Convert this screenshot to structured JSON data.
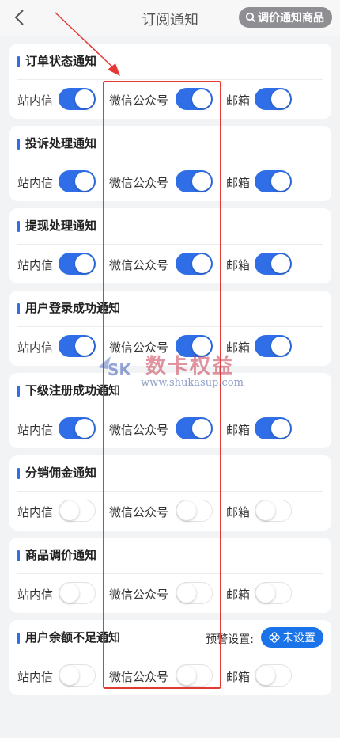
{
  "header": {
    "title": "订阅通知",
    "price_button": "调价通知商品"
  },
  "labels": {
    "site": "站内信",
    "wechat": "微信公众号",
    "email": "邮箱"
  },
  "cards": [
    {
      "title": "订单状态通知",
      "site": true,
      "wechat": true,
      "email": true
    },
    {
      "title": "投诉处理通知",
      "site": true,
      "wechat": true,
      "email": true
    },
    {
      "title": "提现处理通知",
      "site": true,
      "wechat": true,
      "email": true
    },
    {
      "title": "用户登录成功通知",
      "site": true,
      "wechat": true,
      "email": true
    },
    {
      "title": "下级注册成功通知",
      "site": true,
      "wechat": true,
      "email": true
    },
    {
      "title": "分销佣金通知",
      "site": false,
      "wechat": false,
      "email": false
    },
    {
      "title": "商品调价通知",
      "site": false,
      "wechat": false,
      "email": false
    },
    {
      "title": "用户余额不足通知",
      "site": false,
      "wechat": false,
      "email": false
    }
  ],
  "balance_warning": {
    "label": "预警设置:",
    "button": "未设置"
  },
  "watermark": {
    "text": "数卡权益",
    "url": "www.shukasup.com",
    "logo": "SK"
  },
  "colors": {
    "accent": "#2f6ee6",
    "highlight": "#e53935"
  }
}
